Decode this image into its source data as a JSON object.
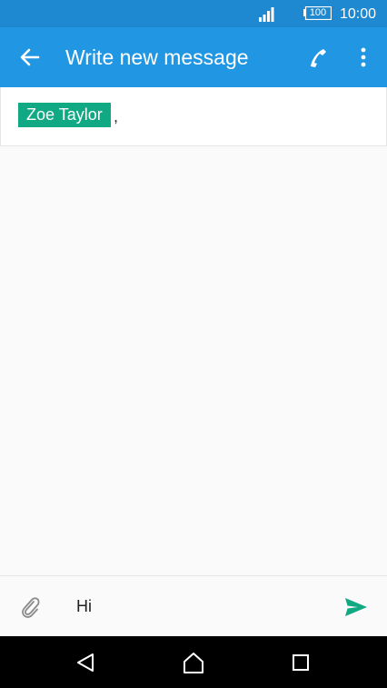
{
  "status_bar": {
    "battery": "100",
    "time": "10:00"
  },
  "app_bar": {
    "title": "Write new message",
    "icons": {
      "back": "arrow-back-icon",
      "call": "phone-icon",
      "more": "more-vert-icon"
    }
  },
  "recipients": {
    "items": [
      {
        "name": "Zoe Taylor"
      }
    ],
    "separator": ","
  },
  "compose": {
    "message_value": "Hi",
    "icons": {
      "attach": "paperclip-icon",
      "send": "send-icon"
    }
  },
  "nav_bar": {
    "icons": [
      "nav-back-icon",
      "nav-home-icon",
      "nav-recent-icon"
    ]
  },
  "colors": {
    "status_bar": "#1e88d0",
    "app_bar": "#2196e3",
    "chip": "#10a983",
    "send": "#10a983"
  }
}
